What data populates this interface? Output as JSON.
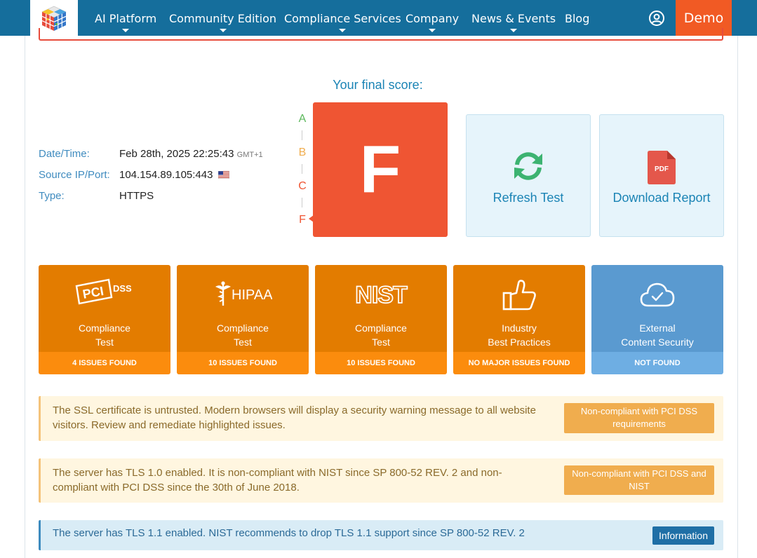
{
  "nav": {
    "items": [
      {
        "label": "AI Platform",
        "has_dropdown": true
      },
      {
        "label": "Community Edition",
        "has_dropdown": true
      },
      {
        "label": "Compliance Services",
        "has_dropdown": true
      },
      {
        "label": "Company",
        "has_dropdown": true
      },
      {
        "label": "News & Events",
        "has_dropdown": true
      },
      {
        "label": "Blog",
        "has_dropdown": false
      }
    ],
    "demo_label": "Demo",
    "user_icon": "user-circle-icon",
    "colors": {
      "bar": "#156e9c",
      "demo": "#f15a24"
    }
  },
  "score": {
    "title": "Your final score:",
    "grade": "F",
    "scale": [
      "A",
      "B",
      "C",
      "F"
    ],
    "scale_colors": [
      "#5cb85c",
      "#f0ad4e",
      "#ef5533",
      "#ef5533"
    ],
    "box_color": "#ef5533"
  },
  "info": {
    "datetime_label": "Date/Time:",
    "datetime_value": "Feb 28th, 2025 22:25:43",
    "timezone": "GMT+1",
    "source_label": "Source IP/Port:",
    "source_value": "104.154.89.105:443",
    "source_flag": "us-flag-icon",
    "type_label": "Type:",
    "type_value": "HTTPS"
  },
  "actions": {
    "refresh_label": "Refresh Test",
    "download_label": "Download Report",
    "pdf_text": "PDF"
  },
  "cards": [
    {
      "logo": "pci-dss-logo",
      "logo_text": "DSS",
      "line1": "Compliance",
      "line2": "Test",
      "status": "4 ISSUES FOUND",
      "color": "orange"
    },
    {
      "logo": "hipaa-logo",
      "logo_text": "HIPAA",
      "line1": "Compliance",
      "line2": "Test",
      "status": "10 ISSUES FOUND",
      "color": "orange"
    },
    {
      "logo": "nist-logo",
      "logo_text": "NIST",
      "line1": "Compliance",
      "line2": "Test",
      "status": "10 ISSUES FOUND",
      "color": "orange"
    },
    {
      "logo": "thumbs-up-icon",
      "line1": "Industry",
      "line2": "Best Practices",
      "status": "NO MAJOR ISSUES FOUND",
      "color": "orange"
    },
    {
      "logo": "cloud-check-icon",
      "line1": "External",
      "line2": "Content Security",
      "status": "NOT FOUND",
      "color": "blue"
    }
  ],
  "alerts": [
    {
      "type": "warning",
      "text": "The SSL certificate is untrusted. Modern browsers will display a security warning message to all website visitors. Review and remediate highlighted issues.",
      "badge": "Non-compliant with PCI DSS requirements"
    },
    {
      "type": "warning",
      "text": "The server has TLS 1.0 enabled. It is non-compliant with NIST since SP 800-52 REV. 2 and non-compliant with PCI DSS since the 30th of June 2018.",
      "badge": "Non-compliant with PCI DSS and NIST"
    },
    {
      "type": "info",
      "text": "The server has TLS 1.1 enabled. NIST recommends to drop TLS 1.1 support since SP 800-52 REV. 2",
      "badge": "Information"
    }
  ]
}
